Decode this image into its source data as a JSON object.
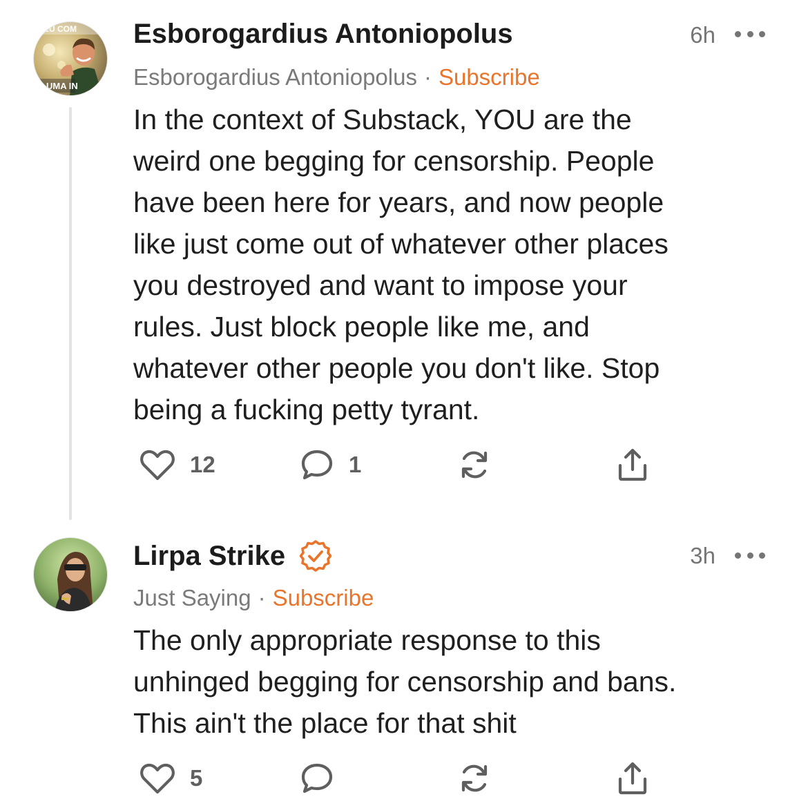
{
  "comments": [
    {
      "author": "Esborogardius Antoniopolus",
      "time": "6h",
      "publication": "Esborogardius Antoniopolus",
      "subscribe_label": "Subscribe",
      "separator": "·",
      "avatar_text_top": "EU COM",
      "avatar_text_bottom": "UMA IN",
      "body_lines": [
        "In the context of Substack, YOU are the",
        "weird one begging for censorship. People",
        "have been here for years, and now people",
        "like just come out of whatever other places",
        "you destroyed and want to impose your",
        "rules. Just block people like me, and",
        "whatever other people you don't like. Stop",
        "being a fucking petty tyrant."
      ],
      "likes": "12",
      "replies": "1",
      "verified": false
    },
    {
      "author": "Lirpa Strike",
      "time": "3h",
      "publication": "Just Saying",
      "subscribe_label": "Subscribe",
      "separator": "·",
      "body_lines": [
        "The only appropriate response to this",
        "unhinged begging for censorship and bans.",
        "This ain't the place for that shit"
      ],
      "likes": "5",
      "replies": "",
      "verified": true
    }
  ],
  "colors": {
    "accent": "#e8752b",
    "text": "#1f1f1f",
    "muted": "#7a7a7a",
    "icon": "#5f5f5f",
    "thread_line": "#e3e3e3"
  },
  "icons": {
    "like": "heart-icon",
    "reply": "speech-bubble-icon",
    "restack": "restack-icon",
    "share": "share-icon",
    "more": "more-dots-icon",
    "verified": "verified-check-icon"
  }
}
